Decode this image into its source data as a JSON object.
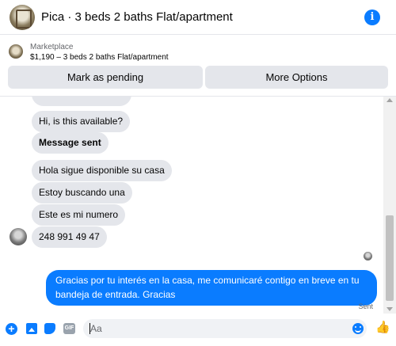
{
  "header": {
    "title": "Pica · 3 beds 2 baths Flat/apartment",
    "info_icon": "info-icon",
    "info_glyph": "i"
  },
  "marketplace": {
    "source": "Marketplace",
    "listing": "$1,190 – 3 beds 2 baths Flat/apartment",
    "buttons": {
      "mark_pending": "Mark as pending",
      "more_options": "More Options"
    }
  },
  "messages": [
    {
      "from": "them",
      "text": "Hi, is this available?"
    },
    {
      "from": "them",
      "text": "Message sent",
      "bold": true
    },
    {
      "from": "them",
      "text": "Hola sigue disponible su casa"
    },
    {
      "from": "them",
      "text": "Estoy buscando una"
    },
    {
      "from": "them",
      "text": "Este es mi numero"
    },
    {
      "from": "them",
      "text": "248 991 49 47"
    },
    {
      "from": "me",
      "text": "Gracias por tu interés en la casa, me comunicaré contigo en breve en tu bandeja de entrada. Gracias"
    }
  ],
  "status": {
    "sent_label": "Sent"
  },
  "composer": {
    "placeholder": "Aa",
    "icons": [
      "plus-icon",
      "image-icon",
      "sticker-icon",
      "gif-icon",
      "emoji-icon",
      "thumbs-up-icon"
    ],
    "gif_label": "GIF",
    "plus_glyph": "+",
    "like_glyph": "👍"
  },
  "colors": {
    "accent": "#0a7cff",
    "bubble_incoming": "#e4e6eb",
    "button_bg": "#e4e6eb"
  }
}
